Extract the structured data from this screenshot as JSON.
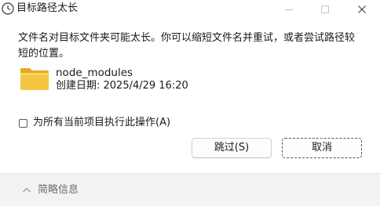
{
  "window": {
    "title": "目标路径太长",
    "minimize_glyph": "—",
    "maximize_glyph": "☐",
    "close_glyph": "✕"
  },
  "message": "文件名对目标文件夹可能太长。你可以缩短文件名并重试，或者尝试路径较短的位置。",
  "file": {
    "icon": "folder-icon",
    "name": "node_modules",
    "created": "创建日期: 2025/4/29 16:20"
  },
  "apply_all": {
    "label": "为所有当前项目执行此操作(A)",
    "checked": false
  },
  "buttons": {
    "skip": "跳过(S)",
    "cancel": "取消"
  },
  "footer": {
    "details_label": "简略信息",
    "chevron_icon": "chevron-up-icon"
  },
  "colors": {
    "folder": "#f4c542",
    "folder_dark": "#e8a91f",
    "footer_bg": "#f3f3f3"
  }
}
